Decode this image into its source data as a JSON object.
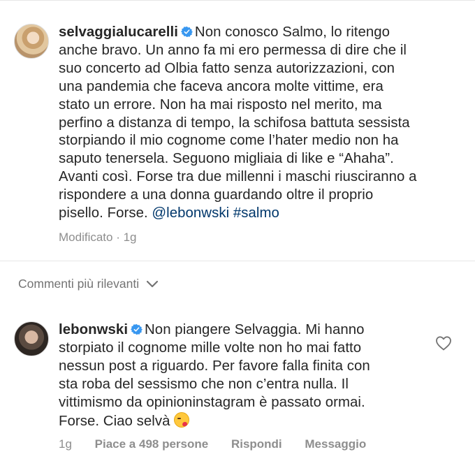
{
  "post": {
    "username": "selvaggialucarelli",
    "text_lines": [
      "Non conosco Salmo, lo ritengo",
      "anche bravo. Un anno fa mi ero permessa di dire che il",
      "suo concerto ad Olbia fatto senza autorizzazioni, con",
      "una pandemia che faceva ancora molte vittime, era",
      "stato un errore. Non ha mai risposto nel merito, ma",
      "perfino a distanza di tempo, la schifosa battuta sessista",
      "storpiando il mio cognome come l’hater medio non ha",
      "saputo tenersela. Seguono migliaia di like e “Ahaha”.",
      "Avanti così. Forse tra due millenni i maschi riusciranno a",
      "rispondere a una donna guardando oltre il proprio",
      "pisello. Forse."
    ],
    "tags": "@lebonwski #salmo",
    "meta": "Modificato · 1g"
  },
  "sort": {
    "label": "Commenti più rilevanti"
  },
  "comment": {
    "username": "lebonwski",
    "text_lines": [
      "Non piangere Selvaggia. Mi hanno",
      "storpiato il cognome mille volte non ho mai fatto",
      "nessun post a riguardo. Per favore falla finita con",
      "sta roba del sessismo che non c’entra nulla. Il",
      "vittimismo da opinioninstagram è passato ormai.",
      "Forse. Ciao selvà"
    ],
    "emoji": "face-blowing-kiss-emoji",
    "time": "1g",
    "likes": "Piace a 498 persone",
    "reply": "Rispondi",
    "message": "Messaggio"
  },
  "colors": {
    "verified": "#3897f0",
    "mention": "#00376b",
    "meta": "#8e8e8e"
  }
}
